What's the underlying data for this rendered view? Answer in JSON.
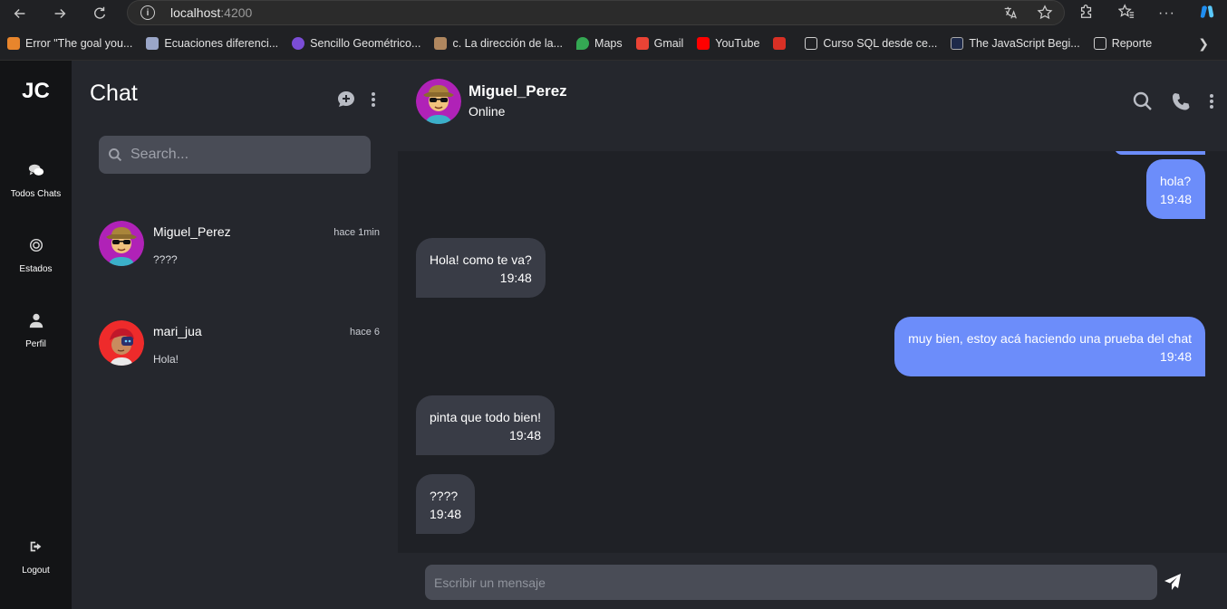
{
  "browser": {
    "address_host": "localhost",
    "address_port": ":4200",
    "bookmarks": [
      {
        "label": "Error \"The goal you...",
        "color": "#e8852c"
      },
      {
        "label": "Ecuaciones diferenci...",
        "color": "#9aa6c8"
      },
      {
        "label": "Sencillo Geométrico...",
        "color": "#7b4dd6"
      },
      {
        "label": "c. La dirección de la...",
        "color": "#b0875f"
      },
      {
        "label": "Maps",
        "color": "#34a853"
      },
      {
        "label": "Gmail",
        "color": "#ea4335"
      },
      {
        "label": "YouTube",
        "color": "#ff0000"
      },
      {
        "label": "",
        "color": "#d93025"
      },
      {
        "label": "Curso SQL desde ce...",
        "color": "#cfcfcf"
      },
      {
        "label": "The JavaScript Begi...",
        "color": "#1e2a4a"
      },
      {
        "label": "Reporte",
        "color": "#cfcfcf"
      }
    ]
  },
  "rail": {
    "logo": "JC",
    "items": [
      {
        "label": "Todos Chats",
        "icon": "chat-bubbles-icon"
      },
      {
        "label": "Estados",
        "icon": "status-icon"
      },
      {
        "label": "Perfil",
        "icon": "user-icon"
      }
    ],
    "logout_label": "Logout"
  },
  "chats": {
    "title": "Chat",
    "search_placeholder": "Search...",
    "items": [
      {
        "name": "Miguel_Perez",
        "time": "hace 1min",
        "preview": "????"
      },
      {
        "name": "mari_jua",
        "time": "hace 6",
        "preview": "Hola!"
      }
    ]
  },
  "conversation": {
    "contact_name": "Miguel_Perez",
    "status": "Online",
    "messages": [
      {
        "direction": "out",
        "text": "hola?",
        "time": "19:48"
      },
      {
        "direction": "in",
        "text": "Hola! como te va?",
        "time": "19:48"
      },
      {
        "direction": "out",
        "text": "muy bien, estoy acá haciendo una prueba del chat",
        "time": "19:48"
      },
      {
        "direction": "in",
        "text": "pinta que todo bien!",
        "time": "19:48"
      },
      {
        "direction": "in",
        "text": "????",
        "time": "19:48"
      }
    ],
    "composer_placeholder": "Escribir un mensaje"
  },
  "colors": {
    "accent_outgoing": "#6c8dfa",
    "incoming_bubble": "#393c46"
  }
}
